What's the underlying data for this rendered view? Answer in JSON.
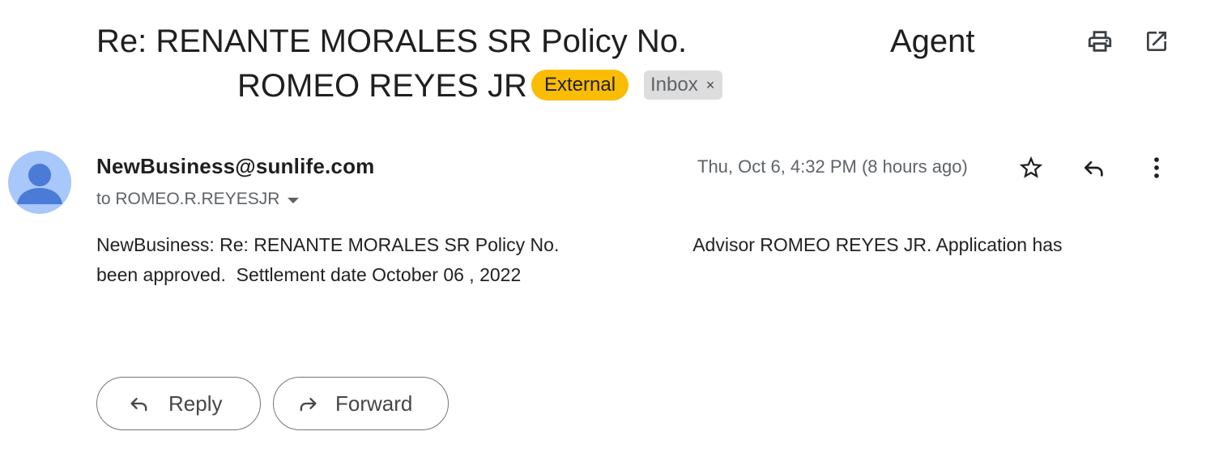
{
  "subject": {
    "line1": "Re: RENANTE MORALES SR Policy No.",
    "line1b": "Agent",
    "line2": "ROMEO REYES JR"
  },
  "labels": {
    "external": "External",
    "inbox": "Inbox",
    "inbox_remove": "×"
  },
  "toolbar": {
    "print_icon": "print-icon",
    "open_new_window_icon": "open-in-new-icon"
  },
  "message": {
    "sender": "NewBusiness@sunlife.com",
    "recipient": "to ROMEO.R.REYESJR",
    "timestamp": "Thu, Oct 6, 4:32 PM (8 hours ago)",
    "body_line1": "NewBusiness: Re: RENANTE MORALES SR Policy No.                          Advisor ROMEO REYES JR. Application has",
    "body_line2": "been approved.  Settlement date October 06 , 2022"
  },
  "actions": {
    "reply": "Reply",
    "forward": "Forward"
  },
  "colors": {
    "external_label": "#fbbc04",
    "inbox_label": "#dddddd",
    "avatar_bg": "#a8c7fa",
    "avatar_fg": "#4a7bd7"
  }
}
